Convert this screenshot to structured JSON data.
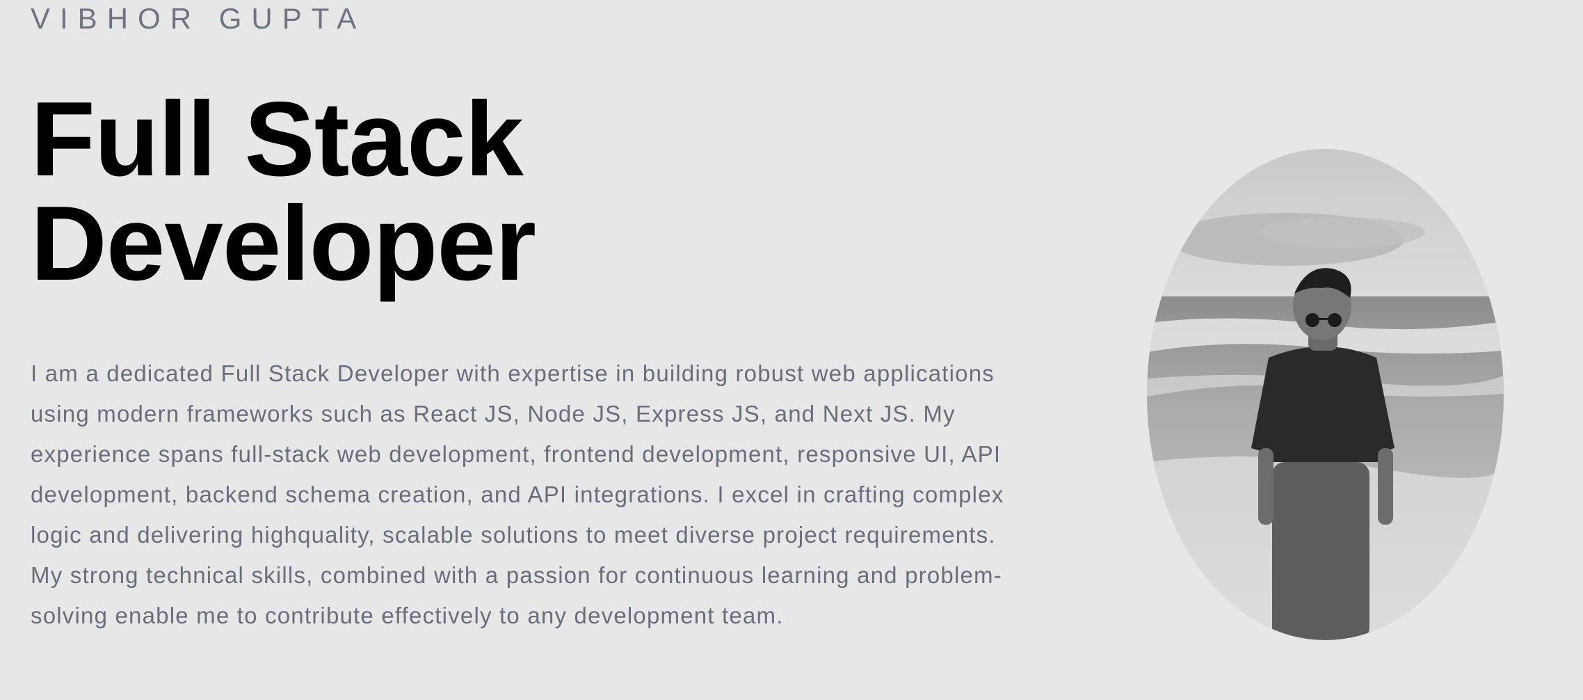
{
  "header": {
    "name": "VIBHOR GUPTA"
  },
  "hero": {
    "title_line1": "Full Stack",
    "title_line2": "Developer",
    "bio": "I am a dedicated Full Stack Developer with expertise in building robust web applications using modern frameworks such as React JS, Node JS, Express JS, and Next JS. My experience spans full-stack web development, frontend development, responsive UI, API development, backend schema creation, and API integrations. I excel in crafting complex logic and delivering highquality, scalable solutions to meet diverse project requirements. My strong technical skills, combined with a passion for continuous learning and problem-solving enable me to contribute effectively to any development team."
  },
  "colors": {
    "background": "#e7e7e7",
    "name_text": "#707481",
    "title_text": "#000000",
    "bio_text": "#6a6e7b"
  }
}
